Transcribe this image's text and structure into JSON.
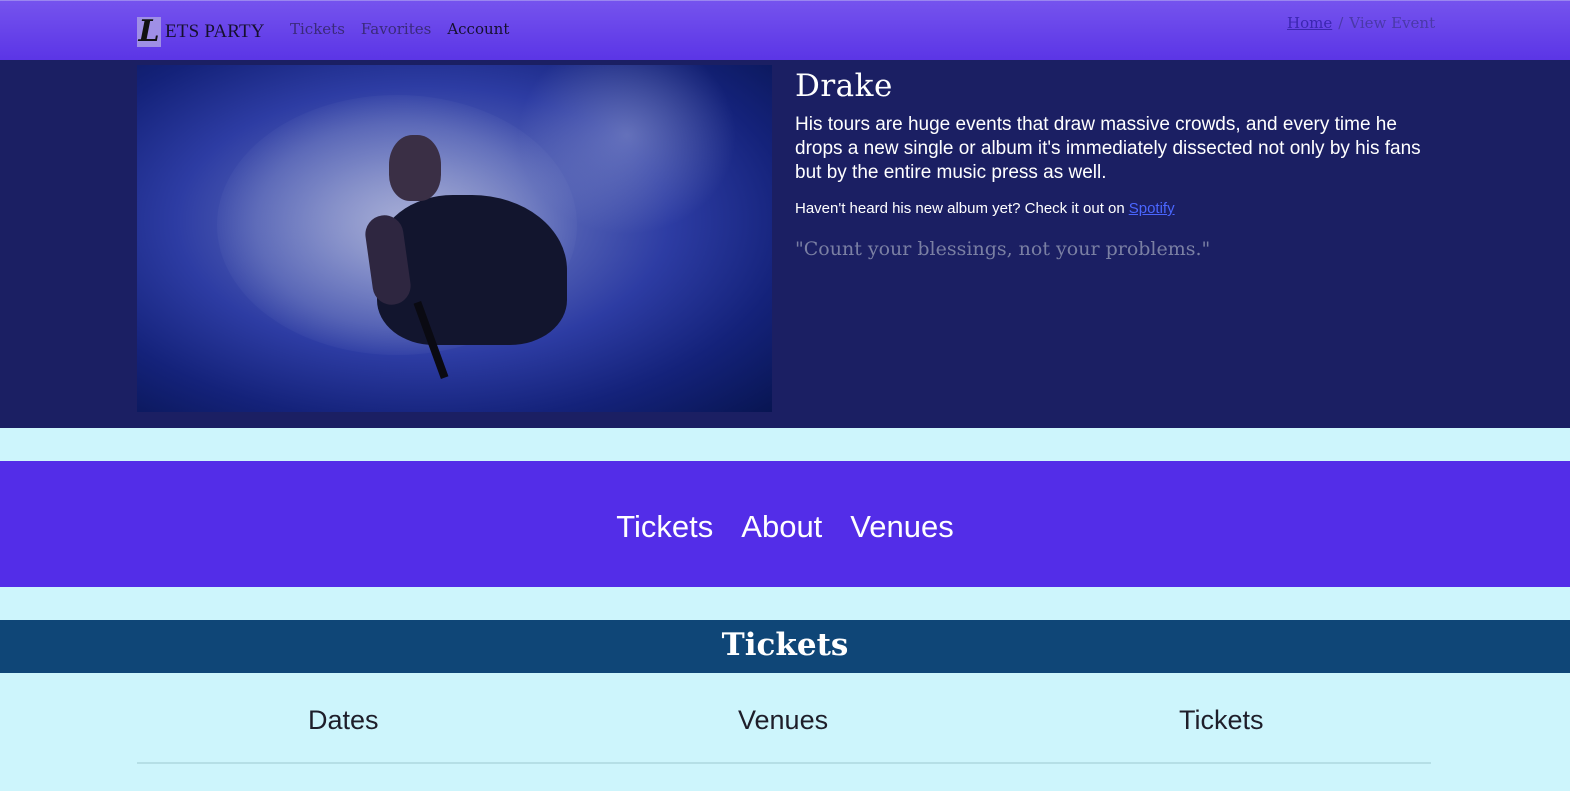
{
  "navbar": {
    "brand_initial": "L",
    "brand_text": "ETS PARTY",
    "links": [
      {
        "label": "Tickets"
      },
      {
        "label": "Favorites"
      },
      {
        "label": "Account"
      }
    ],
    "breadcrumb": {
      "home": "Home",
      "separator": "/",
      "current": "View Event"
    }
  },
  "hero": {
    "image_alt": "Drake performing on stage in smoke",
    "artist": "Drake",
    "bio": "His tours are huge events that draw massive crowds, and every time he drops a new single or album it's immediately dissected not only by his fans but by the entire music press as well.",
    "listen_text": "Haven't heard his new album yet? Check it out on",
    "listen_link": "Spotify",
    "quote": "\"Count your blessings, not your problems.\""
  },
  "section_nav": {
    "tabs": [
      {
        "label": "Tickets"
      },
      {
        "label": "About"
      },
      {
        "label": "Venues"
      }
    ]
  },
  "tickets": {
    "title": "Tickets",
    "columns": [
      "Dates",
      "Venues",
      "Tickets"
    ]
  },
  "colors": {
    "navbar": "#5b35e6",
    "hero_bg": "#1b1f63",
    "section_nav": "#532de8",
    "tickets_header": "#0f4677",
    "page_bg": "#cdf5fc"
  }
}
